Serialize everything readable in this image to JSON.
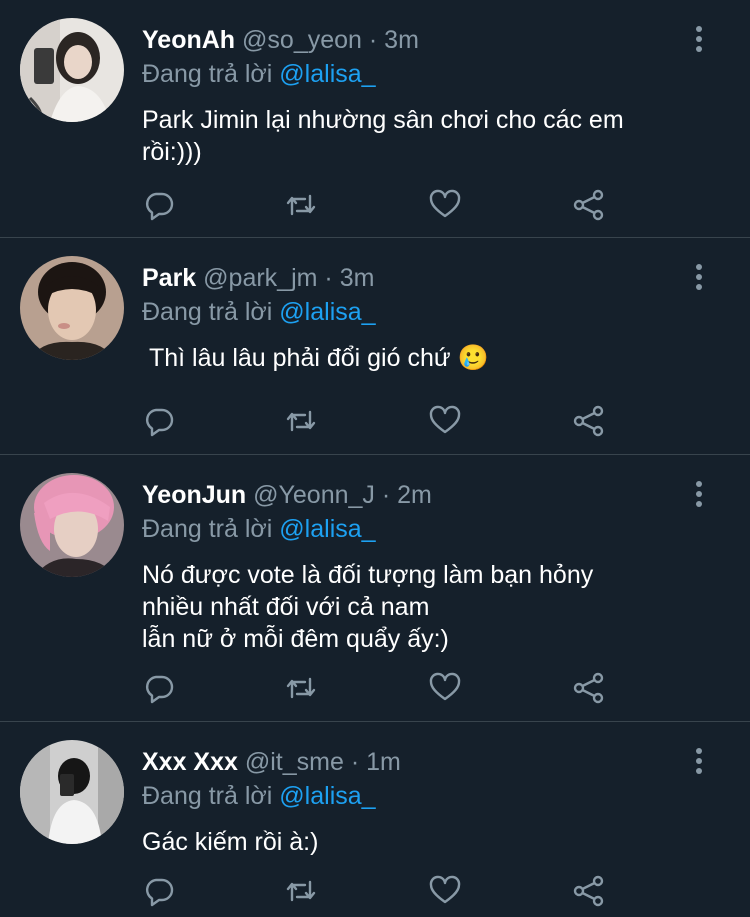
{
  "tweets": [
    {
      "name": "YeonAh",
      "handle": "@so_yeon",
      "dot": "·",
      "time": "3m",
      "replying_prefix": "Đang trả lời",
      "replying_to": "@lalisa_",
      "text": "Park Jimin lại nhường sân chơi cho các em\nrồi:)))",
      "avatar_colors": [
        "#e9e6e2",
        "#2b2623"
      ]
    },
    {
      "name": "Park",
      "handle": "@park_jm",
      "dot": "·",
      "time": "3m",
      "replying_prefix": "Đang trả lời",
      "replying_to": "@lalisa_",
      "text": " Thì lâu lâu phải đổi gió chứ 🥲",
      "avatar_colors": [
        "#d9c2ad",
        "#1c1512"
      ]
    },
    {
      "name": "YeonJun",
      "handle": "@Yeonn_J",
      "dot": "·",
      "time": "2m",
      "replying_prefix": "Đang trả lời",
      "replying_to": "@lalisa_",
      "text": "Nó được vote là đối tượng làm bạn hỏny\nnhiều nhất đối với cả nam\nlẫn nữ ở mỗi đêm quẩy ấy:)",
      "avatar_colors": [
        "#e59ab5",
        "#8d6a74"
      ]
    },
    {
      "name": "Xxx Xxx",
      "handle": "@it_sme",
      "dot": "·",
      "time": "1m",
      "replying_prefix": "Đang trả lời",
      "replying_to": "@lalisa_",
      "text": "Gác kiếm rồi à:)",
      "avatar_colors": [
        "#c9c9c9",
        "#1a1a1a"
      ]
    }
  ],
  "icons": {
    "reply": "reply-icon",
    "retweet": "retweet-icon",
    "like": "heart-icon",
    "share": "share-icon",
    "more": "more-options-icon"
  },
  "colors": {
    "background": "#15202b",
    "divider": "#38444d",
    "muted": "#8899a6",
    "mention": "#1da1f2"
  }
}
